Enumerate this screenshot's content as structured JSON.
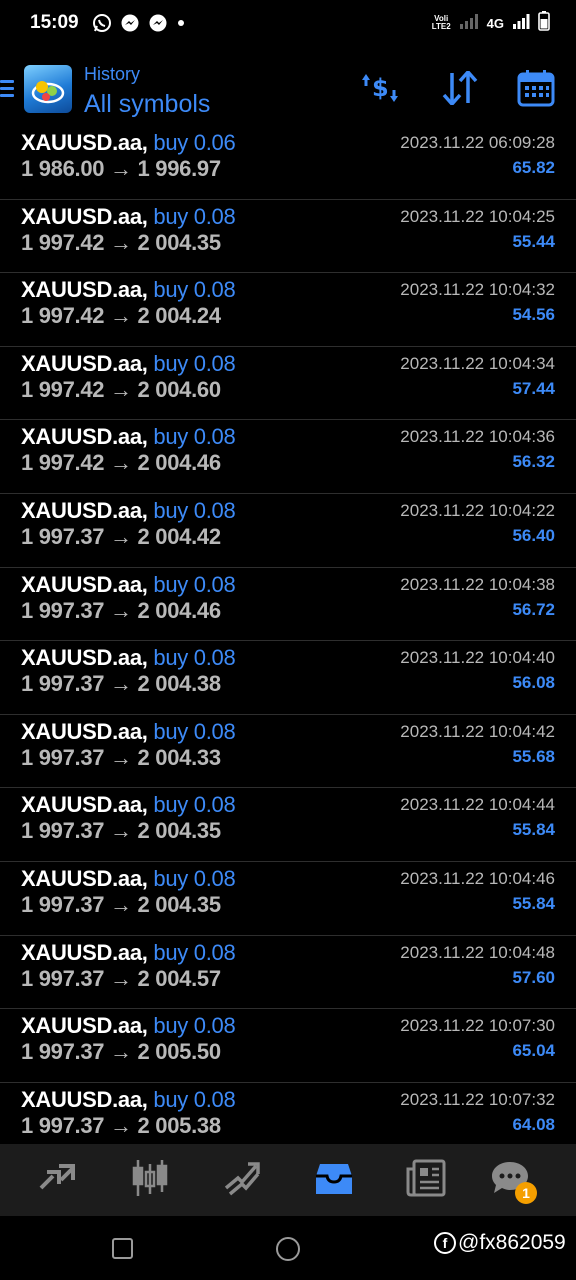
{
  "status_bar": {
    "time": "15:09",
    "network_label": "4G",
    "volte_label": "Voli\nLTE2",
    "notification_icons": [
      "whatsapp-icon",
      "messenger-icon",
      "messenger-icon",
      "dot-icon"
    ]
  },
  "header": {
    "subtitle": "History",
    "title": "All symbols",
    "accent_color": "#3d8af7",
    "actions": [
      "currency-swap-icon",
      "sort-icon",
      "calendar-icon"
    ]
  },
  "trades": [
    {
      "symbol": "XAUUSD.aa,",
      "side": "buy 0.06",
      "prices": "1 986.00 → 1 996.97",
      "time": "2023.11.22 06:09:28",
      "profit": "65.82"
    },
    {
      "symbol": "XAUUSD.aa,",
      "side": "buy 0.08",
      "prices": "1 997.42 → 2 004.35",
      "time": "2023.11.22 10:04:25",
      "profit": "55.44"
    },
    {
      "symbol": "XAUUSD.aa,",
      "side": "buy 0.08",
      "prices": "1 997.42 → 2 004.24",
      "time": "2023.11.22 10:04:32",
      "profit": "54.56"
    },
    {
      "symbol": "XAUUSD.aa,",
      "side": "buy 0.08",
      "prices": "1 997.42 → 2 004.60",
      "time": "2023.11.22 10:04:34",
      "profit": "57.44"
    },
    {
      "symbol": "XAUUSD.aa,",
      "side": "buy 0.08",
      "prices": "1 997.42 → 2 004.46",
      "time": "2023.11.22 10:04:36",
      "profit": "56.32"
    },
    {
      "symbol": "XAUUSD.aa,",
      "side": "buy 0.08",
      "prices": "1 997.37 → 2 004.42",
      "time": "2023.11.22 10:04:22",
      "profit": "56.40"
    },
    {
      "symbol": "XAUUSD.aa,",
      "side": "buy 0.08",
      "prices": "1 997.37 → 2 004.46",
      "time": "2023.11.22 10:04:38",
      "profit": "56.72"
    },
    {
      "symbol": "XAUUSD.aa,",
      "side": "buy 0.08",
      "prices": "1 997.37 → 2 004.38",
      "time": "2023.11.22 10:04:40",
      "profit": "56.08"
    },
    {
      "symbol": "XAUUSD.aa,",
      "side": "buy 0.08",
      "prices": "1 997.37 → 2 004.33",
      "time": "2023.11.22 10:04:42",
      "profit": "55.68"
    },
    {
      "symbol": "XAUUSD.aa,",
      "side": "buy 0.08",
      "prices": "1 997.37 → 2 004.35",
      "time": "2023.11.22 10:04:44",
      "profit": "55.84"
    },
    {
      "symbol": "XAUUSD.aa,",
      "side": "buy 0.08",
      "prices": "1 997.37 → 2 004.35",
      "time": "2023.11.22 10:04:46",
      "profit": "55.84"
    },
    {
      "symbol": "XAUUSD.aa,",
      "side": "buy 0.08",
      "prices": "1 997.37 → 2 004.57",
      "time": "2023.11.22 10:04:48",
      "profit": "57.60"
    },
    {
      "symbol": "XAUUSD.aa,",
      "side": "buy 0.08",
      "prices": "1 997.37 → 2 005.50",
      "time": "2023.11.22 10:07:30",
      "profit": "65.04"
    },
    {
      "symbol": "XAUUSD.aa,",
      "side": "buy 0.08",
      "prices": "1 997.37 → 2 005.38",
      "time": "2023.11.22 10:07:32",
      "profit": "64.08"
    }
  ],
  "bottom_nav": {
    "items": [
      "quotes-icon",
      "chart-icon",
      "trade-icon",
      "history-icon",
      "news-icon",
      "chat-icon"
    ],
    "active": "history-icon",
    "chat_badge": "1"
  },
  "watermark": {
    "handle": "@fx862059"
  }
}
